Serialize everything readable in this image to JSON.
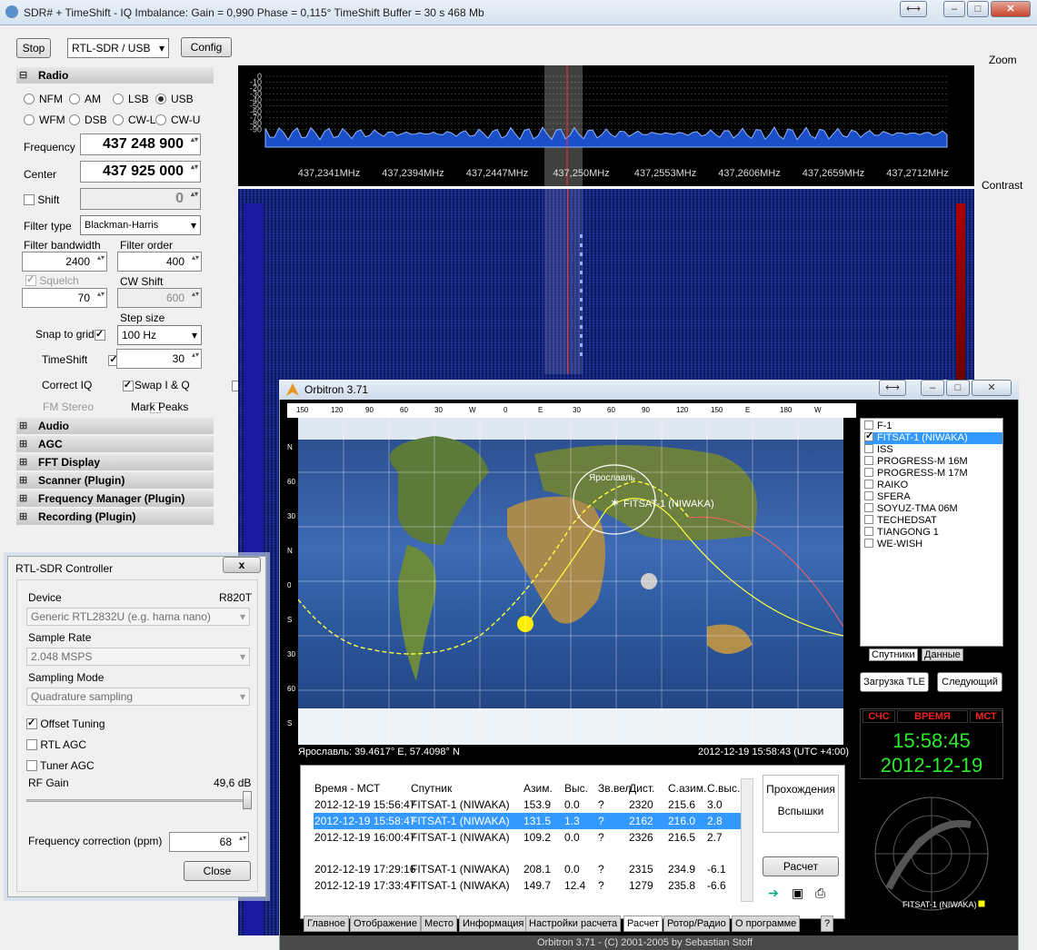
{
  "window": {
    "title": "SDR# + TimeShift - IQ Imbalance: Gain = 0,990 Phase = 0,115° TimeShift Buffer = 30 s  468 Mb"
  },
  "toolbar": {
    "stop": "Stop",
    "source": "RTL-SDR / USB",
    "config": "Config"
  },
  "radio": {
    "section": "Radio",
    "modes": [
      "NFM",
      "AM",
      "LSB",
      "USB",
      "WFM",
      "DSB",
      "CW-L",
      "CW-U"
    ],
    "selected_mode": "USB",
    "frequency_label": "Frequency",
    "frequency": "437 248 900",
    "center_label": "Center",
    "center": "437 925 000",
    "shift_label": "Shift",
    "shift": "0",
    "filter_type_label": "Filter type",
    "filter_type": "Blackman-Harris",
    "filter_bw_label": "Filter bandwidth",
    "filter_bw": "2400",
    "filter_order_label": "Filter order",
    "filter_order": "400",
    "squelch_label": "Squelch",
    "squelch": "70",
    "cw_shift_label": "CW Shift",
    "cw_shift": "600",
    "step_size_label": "Step size",
    "step_size": "100 Hz",
    "snap_label": "Snap to grid",
    "timeshift_label": "TimeShift",
    "timeshift": "30",
    "correct_iq_label": "Correct IQ",
    "swap_iq_label": "Swap I & Q",
    "fm_stereo_label": "FM Stereo",
    "mark_peaks_label": "Mark Peaks"
  },
  "sections": [
    "Audio",
    "AGC",
    "FFT Display",
    "Scanner (Plugin)",
    "Frequency Manager (Plugin)",
    "Recording (Plugin)"
  ],
  "spectrum": {
    "zoom_label": "Zoom",
    "contrast_label": "Contrast",
    "db_ticks": [
      "0",
      "-10",
      "-20",
      "-30",
      "-40",
      "-50",
      "-60",
      "-70",
      "-80",
      "-90"
    ],
    "freq_ticks": [
      "437,2341MHz",
      "437,2394MHz",
      "437,2447MHz",
      "437,250MHz",
      "437,2553MHz",
      "437,2606MHz",
      "437,2659MHz",
      "437,2712MHz"
    ]
  },
  "rtl": {
    "title": "RTL-SDR Controller",
    "close": "x",
    "device_label": "Device",
    "device_tuner": "R820T",
    "device": "Generic RTL2832U (e.g. hama nano)",
    "sample_rate_label": "Sample Rate",
    "sample_rate": "2.048 MSPS",
    "sampling_mode_label": "Sampling Mode",
    "sampling_mode": "Quadrature sampling",
    "offset_tuning": "Offset Tuning",
    "rtl_agc": "RTL AGC",
    "tuner_agc": "Tuner AGC",
    "rf_gain_label": "RF Gain",
    "rf_gain": "49,6 dB",
    "freq_corr_label": "Frequency correction (ppm)",
    "freq_corr": "68",
    "close_button": "Close"
  },
  "orbitron": {
    "title": "Orbitron 3.71",
    "lon_ticks": [
      "150",
      "120",
      "90",
      "60",
      "30",
      "W",
      "0",
      "E",
      "30",
      "60",
      "90",
      "120",
      "150",
      "E",
      "180",
      "W"
    ],
    "lat_ticks": [
      "N",
      "60",
      "30",
      "N",
      "0",
      "S",
      "30",
      "60",
      "S"
    ],
    "city": "Ярославль",
    "sat_label": "FITSAT-1 (NIWAKA)",
    "location": "Ярославль: 39.4617° E, 57.4098° N",
    "datetime": "2012-12-19 15:58:43 (UTC +4:00)",
    "satellites": [
      "F-1",
      "FITSAT-1 (NIWAKA)",
      "ISS",
      "PROGRESS-M 16M",
      "PROGRESS-M 17M",
      "RAIKO",
      "SFERA",
      "SOYUZ-TMA 06M",
      "TECHEDSAT",
      "TIANGONG 1",
      "WE-WISH"
    ],
    "list_tabs": [
      "Спутники",
      "Данные"
    ],
    "tle_button": "Загрузка TLE",
    "next_button": "Следующий",
    "clock_labels": [
      "СЧС",
      "ВРЕМЯ",
      "МСТ"
    ],
    "clock_time": "15:58:45",
    "clock_date": "2012-12-19",
    "table_headers": [
      "Время - МСТ",
      "Спутник",
      "Азим.",
      "Выс.",
      "Зв.вел.",
      "Дист.",
      "С.азим.",
      "С.выс."
    ],
    "rows": [
      [
        "2012-12-19 15:56:47",
        "FITSAT-1 (NIWAKA)",
        "153.9",
        "0.0",
        "?",
        "2320",
        "215.6",
        "3.0"
      ],
      [
        "2012-12-19 15:58:47",
        "FITSAT-1 (NIWAKA)",
        "131.5",
        "1.3",
        "?",
        "2162",
        "216.0",
        "2.8"
      ],
      [
        "2012-12-19 16:00:47",
        "FITSAT-1 (NIWAKA)",
        "109.2",
        "0.0",
        "?",
        "2326",
        "216.5",
        "2.7"
      ],
      [
        "2012-12-19 17:29:16",
        "FITSAT-1 (NIWAKA)",
        "208.1",
        "0.0",
        "?",
        "2315",
        "234.9",
        "-6.1"
      ],
      [
        "2012-12-19 17:33:47",
        "FITSAT-1 (NIWAKA)",
        "149.7",
        "12.4",
        "?",
        "1279",
        "235.8",
        "-6.6"
      ]
    ],
    "side_buttons": [
      "Прохождения",
      "Вспышки"
    ],
    "calc_button": "Расчет",
    "tabs": [
      "Главное",
      "Отображение",
      "Место",
      "Информация",
      "Настройки расчета",
      "Расчет",
      "Ротор/Радио",
      "О программе",
      "?"
    ],
    "radar_label": "FITSAT-1 (NIWAKA)",
    "status": "Orbitron 3.71 - (C) 2001-2005 by Sebastian Stoff"
  }
}
